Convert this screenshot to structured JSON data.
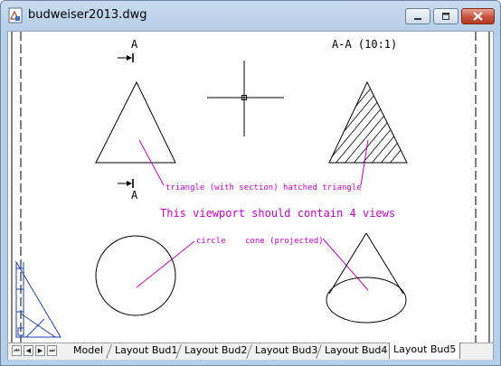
{
  "window": {
    "title": "budweiser2013.dwg",
    "icon": "dwg-file-icon",
    "close_color": "#c8503a"
  },
  "drawing": {
    "section_label_top": "A",
    "section_label_bottom": "A",
    "section_view_title": "A-A (10:1)",
    "viewport_note": "This viewport should contain 4 views",
    "label_color": "#cc00cc",
    "annotations": {
      "triangle": "triangle (with section)",
      "hatched_triangle": "hatched triangle",
      "circle": "circle",
      "cone": "cone (projected)"
    }
  },
  "tabs": {
    "nav": [
      "first",
      "prev",
      "next",
      "last"
    ],
    "items": [
      "Model",
      "Layout Bud1",
      "Layout Bud2",
      "Layout Bud3",
      "Layout Bud4",
      "Layout Bud5"
    ],
    "active": "Layout Bud5"
  }
}
